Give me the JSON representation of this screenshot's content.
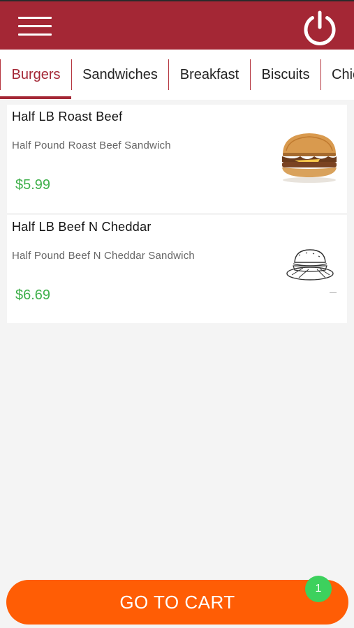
{
  "header": {
    "menu_icon": "hamburger-menu-icon",
    "power_icon": "power-icon",
    "brand_color": "#a42735"
  },
  "tabs": [
    {
      "label": "Burgers",
      "active": true
    },
    {
      "label": "Sandwiches",
      "active": false
    },
    {
      "label": "Breakfast",
      "active": false
    },
    {
      "label": "Biscuits",
      "active": false
    },
    {
      "label": "Chic",
      "active": false
    }
  ],
  "products": [
    {
      "name": "Half LB Roast Beef",
      "description": "Half Pound Roast Beef Sandwich",
      "price": "$5.99",
      "image_icon": "roast-beef-burger-photo"
    },
    {
      "name": "Half LB Beef N Cheddar",
      "description": "Half Pound Beef N Cheddar Sandwich",
      "price": "$6.69",
      "image_icon": "burger-sketch-icon"
    }
  ],
  "cart": {
    "button_label": "GO TO CART",
    "count": "1",
    "button_color": "#ff5d05",
    "badge_color": "#3dd15d"
  },
  "colors": {
    "price": "#3fb04b",
    "background": "#f4f4f4"
  }
}
